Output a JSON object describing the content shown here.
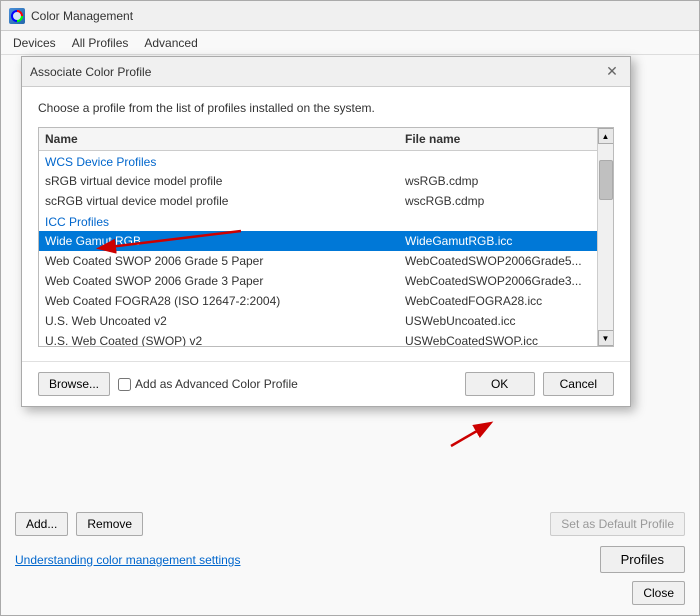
{
  "mainWindow": {
    "title": "Color Management",
    "menu": [
      "Devices",
      "All Profiles",
      "Advanced"
    ]
  },
  "dialog": {
    "title": "Associate Color Profile",
    "description": "Choose a profile from the list of profiles installed on the system.",
    "tableHeaders": {
      "name": "Name",
      "filename": "File name"
    },
    "profiles": [
      {
        "type": "category",
        "name": "WCS Device Profiles",
        "filename": ""
      },
      {
        "type": "row",
        "name": "sRGB virtual device model profile",
        "filename": "wsRGB.cdmp"
      },
      {
        "type": "row",
        "name": "scRGB virtual device model profile",
        "filename": "wscRGB.cdmp"
      },
      {
        "type": "category",
        "name": "ICC Profiles",
        "filename": ""
      },
      {
        "type": "row",
        "name": "Wide Gamut RGB",
        "filename": "WideGamutRGB.icc",
        "selected": true
      },
      {
        "type": "row",
        "name": "Web Coated SWOP 2006 Grade 5 Paper",
        "filename": "WebCoatedSWOP2006Grade5..."
      },
      {
        "type": "row",
        "name": "Web Coated SWOP 2006 Grade 3 Paper",
        "filename": "WebCoatedSWOP2006Grade3..."
      },
      {
        "type": "row",
        "name": "Web Coated FOGRA28 (ISO 12647-2:2004)",
        "filename": "WebCoatedFOGRA28.icc"
      },
      {
        "type": "row",
        "name": "U.S. Web Uncoated v2",
        "filename": "USWebUncoated.icc"
      },
      {
        "type": "row",
        "name": "U.S. Web Coated (SWOP) v2",
        "filename": "USWebCoatedSWOP.icc"
      }
    ],
    "buttons": {
      "browse": "Browse...",
      "addAdvancedLabel": "Add as Advanced Color Profile",
      "ok": "OK",
      "cancel": "Cancel"
    }
  },
  "mainBottom": {
    "addBtn": "Add...",
    "removeBtn": "Remove",
    "setDefaultBtn": "Set as Default Profile",
    "linkText": "Understanding color management settings",
    "profilesBtn": "Profiles",
    "closeBtn": "Close"
  }
}
